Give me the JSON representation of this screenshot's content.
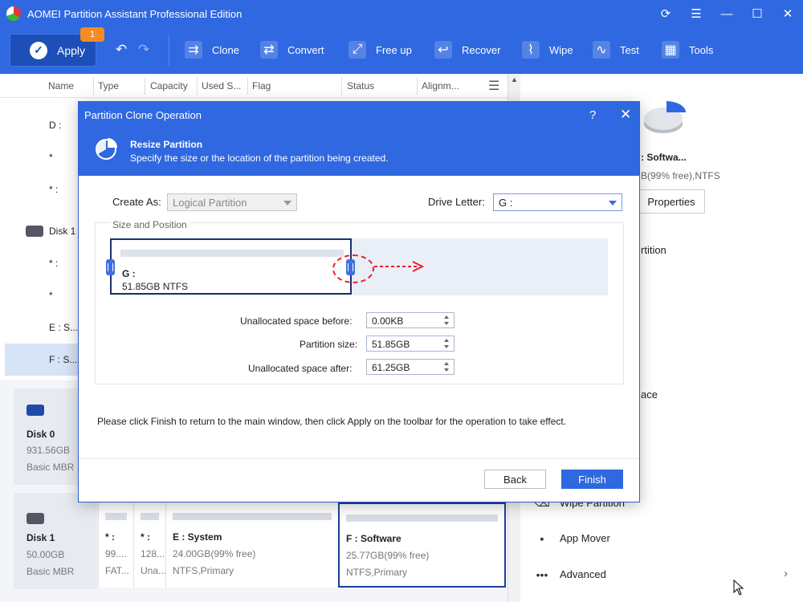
{
  "window": {
    "title": "AOMEI Partition Assistant Professional Edition"
  },
  "toolbar": {
    "apply": "Apply",
    "badge": "1",
    "tools": [
      {
        "label": "Clone",
        "icon": "clone-icon"
      },
      {
        "label": "Convert",
        "icon": "convert-icon"
      },
      {
        "label": "Free up",
        "icon": "free-up-icon"
      },
      {
        "label": "Recover",
        "icon": "recover-icon"
      },
      {
        "label": "Wipe",
        "icon": "wipe-icon"
      },
      {
        "label": "Test",
        "icon": "test-icon"
      },
      {
        "label": "Tools",
        "icon": "tools-icon"
      }
    ]
  },
  "table": {
    "columns": [
      "Name",
      "Type",
      "Capacity",
      "Used S...",
      "Flag",
      "Status",
      "Alignm..."
    ],
    "rows": [
      {
        "name": "D :"
      },
      {
        "name": "*"
      },
      {
        "name": "* :"
      },
      {
        "name": "Disk 1"
      },
      {
        "name": "* :"
      },
      {
        "name": "*"
      },
      {
        "name": "E : S..."
      },
      {
        "name": "F : S..."
      }
    ]
  },
  "disks": [
    {
      "name": "Disk 0",
      "size": "931.56GB",
      "type": "Basic MBR"
    },
    {
      "name": "Disk 1",
      "size": "50.00GB",
      "type": "Basic MBR"
    }
  ],
  "disk1_partitions": [
    {
      "name": "* :",
      "size": "99....",
      "type": "FAT..."
    },
    {
      "name": "* :",
      "size": "128....",
      "type": "Una..."
    },
    {
      "name": "E : System",
      "size": "24.00GB(99% free)",
      "type": "NTFS,Primary"
    },
    {
      "name": "F : Software",
      "size": "25.77GB(99% free)",
      "type": "NTFS,Primary"
    }
  ],
  "right_panel": {
    "name": ": Softwa...",
    "detail": "B(99% free),NTFS",
    "properties": "Properties",
    "ops": [
      {
        "label": "rtition",
        "icon": ""
      },
      {
        "label": "ace",
        "icon": ""
      },
      {
        "label": "Wipe Partition",
        "icon": "wipe-partition-icon"
      },
      {
        "label": "App Mover",
        "icon": "app-mover-icon"
      },
      {
        "label": "Advanced",
        "icon": "more-icon"
      }
    ]
  },
  "dialog": {
    "title": "Partition Clone Operation",
    "help": "?",
    "close": "✕",
    "header_title": "Resize Partition",
    "header_desc": "Specify the size or the location of the partition being created.",
    "create_as_label": "Create As:",
    "create_as_value": "Logical Partition",
    "drive_letter_label": "Drive Letter:",
    "drive_letter_value": "G :",
    "group_title": "Size and Position",
    "partition_name": "G :",
    "partition_size": "51.85GB NTFS",
    "unalloc_before_label": "Unallocated space before:",
    "unalloc_before_value": "0.00KB",
    "partition_size_label": "Partition size:",
    "partition_size_value": "51.85GB",
    "unalloc_after_label": "Unallocated space after:",
    "unalloc_after_value": "61.25GB",
    "note": "Please click Finish to return to the main window, then click Apply on the toolbar for the operation to take effect.",
    "back": "Back",
    "finish": "Finish"
  }
}
